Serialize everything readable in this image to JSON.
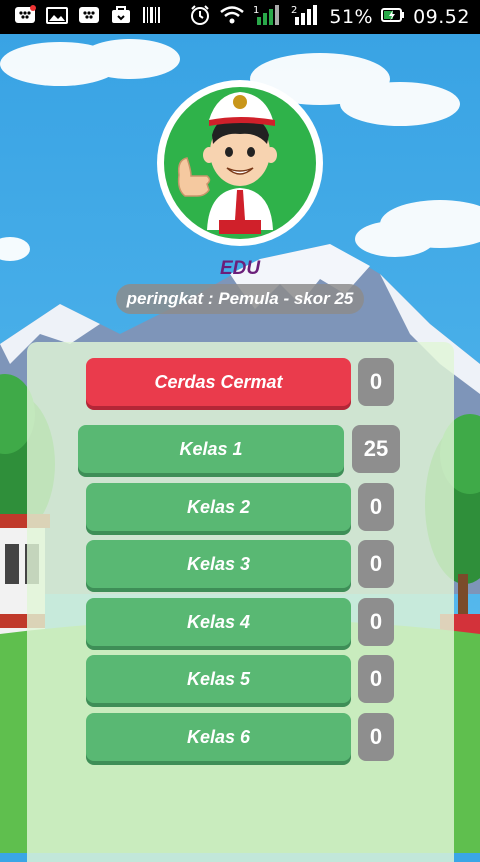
{
  "status_bar": {
    "battery_percent": "51%",
    "time": "09.52",
    "signal_sim1": "1",
    "signal_sim2": "2",
    "icons": [
      "bbm-icon",
      "image-icon",
      "bbm-icon",
      "briefcase-icon",
      "barcode-icon",
      "alarm-icon",
      "wifi-icon",
      "signal-icon",
      "battery-charging-icon"
    ]
  },
  "profile": {
    "name": "EDU",
    "rank_text": "peringkat : Pemula - skor 25"
  },
  "menu": [
    {
      "label": "Cerdas Cermat",
      "score": "0",
      "color": "#ea3b4c"
    },
    {
      "label": "Kelas 1",
      "score": "25",
      "color": "#59b873"
    },
    {
      "label": "Kelas 2",
      "score": "0",
      "color": "#59b873"
    },
    {
      "label": "Kelas 3",
      "score": "0",
      "color": "#59b873"
    },
    {
      "label": "Kelas 4",
      "score": "0",
      "color": "#59b873"
    },
    {
      "label": "Kelas 5",
      "score": "0",
      "color": "#59b873"
    },
    {
      "label": "Kelas 6",
      "score": "0",
      "color": "#59b873"
    }
  ],
  "colors": {
    "sky": "#3aa6e6",
    "name_text": "#6b1f7a",
    "score_box": "#8e8e8e"
  }
}
